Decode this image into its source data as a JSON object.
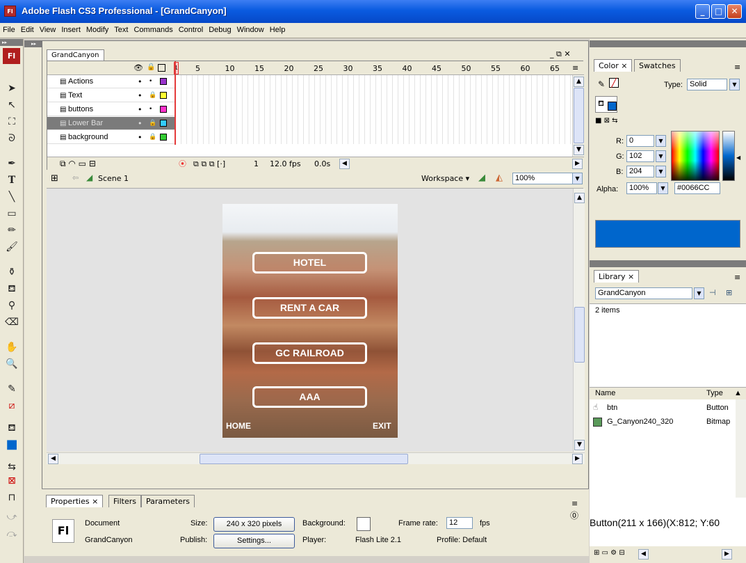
{
  "window": {
    "title": "Adobe Flash CS3 Professional - [GrandCanyon]",
    "app_icon": "Fl"
  },
  "menu": [
    "File",
    "Edit",
    "View",
    "Insert",
    "Modify",
    "Text",
    "Commands",
    "Control",
    "Debug",
    "Window",
    "Help"
  ],
  "tools_logo": "Fl",
  "document_tab": "GrandCanyon",
  "timeline": {
    "frame_ticks": [
      "5",
      "10",
      "15",
      "20",
      "25",
      "30",
      "35",
      "40",
      "45",
      "50",
      "55",
      "60",
      "65"
    ],
    "layers": [
      {
        "name": "Actions",
        "color": "#9933cc"
      },
      {
        "name": "Text",
        "color": "#ffff33"
      },
      {
        "name": "buttons",
        "color": "#ff33cc"
      },
      {
        "name": "Lower Bar",
        "color": "#33ccff"
      },
      {
        "name": "background",
        "color": "#33cc33"
      }
    ],
    "current_frame": "1",
    "fps": "12.0 fps",
    "time": "0.0s"
  },
  "scenebar": {
    "scene": "Scene 1",
    "workspace": "Workspace ▾",
    "zoom": "100%"
  },
  "stage": {
    "buttons": [
      "HOTEL",
      "RENT A CAR",
      "GC RAILROAD",
      "AAA"
    ],
    "home": "HOME",
    "exit": "EXIT"
  },
  "properties": {
    "tabs": [
      "Properties",
      "Filters",
      "Parameters"
    ],
    "doc_label": "Document",
    "doc_name": "GrandCanyon",
    "size_label": "Size:",
    "size_value": "240 x 320 pixels",
    "publish_label": "Publish:",
    "settings_btn": "Settings...",
    "background_label": "Background:",
    "framerate_label": "Frame rate:",
    "framerate_value": "12",
    "fps_unit": "fps",
    "player_label": "Player:",
    "player_value": "Flash Lite 2.1",
    "profile": "Profile: Default"
  },
  "color_panel": {
    "tabs": [
      "Color",
      "Swatches"
    ],
    "type_label": "Type:",
    "type_value": "Solid",
    "r_label": "R:",
    "r": "0",
    "g_label": "G:",
    "g": "102",
    "b_label": "B:",
    "b": "204",
    "alpha_label": "Alpha:",
    "alpha": "100%",
    "hex": "#0066CC",
    "fill_color": "#0066cc"
  },
  "library": {
    "tab": "Library",
    "doc": "GrandCanyon",
    "count": "2 items",
    "col_name": "Name",
    "col_type": "Type",
    "items": [
      {
        "name": "btn",
        "type": "Button"
      },
      {
        "name": "G_Canyon240_320",
        "type": "Bitmap"
      }
    ],
    "preview_text": "Button(211 x 166)(X:812; Y:60"
  }
}
